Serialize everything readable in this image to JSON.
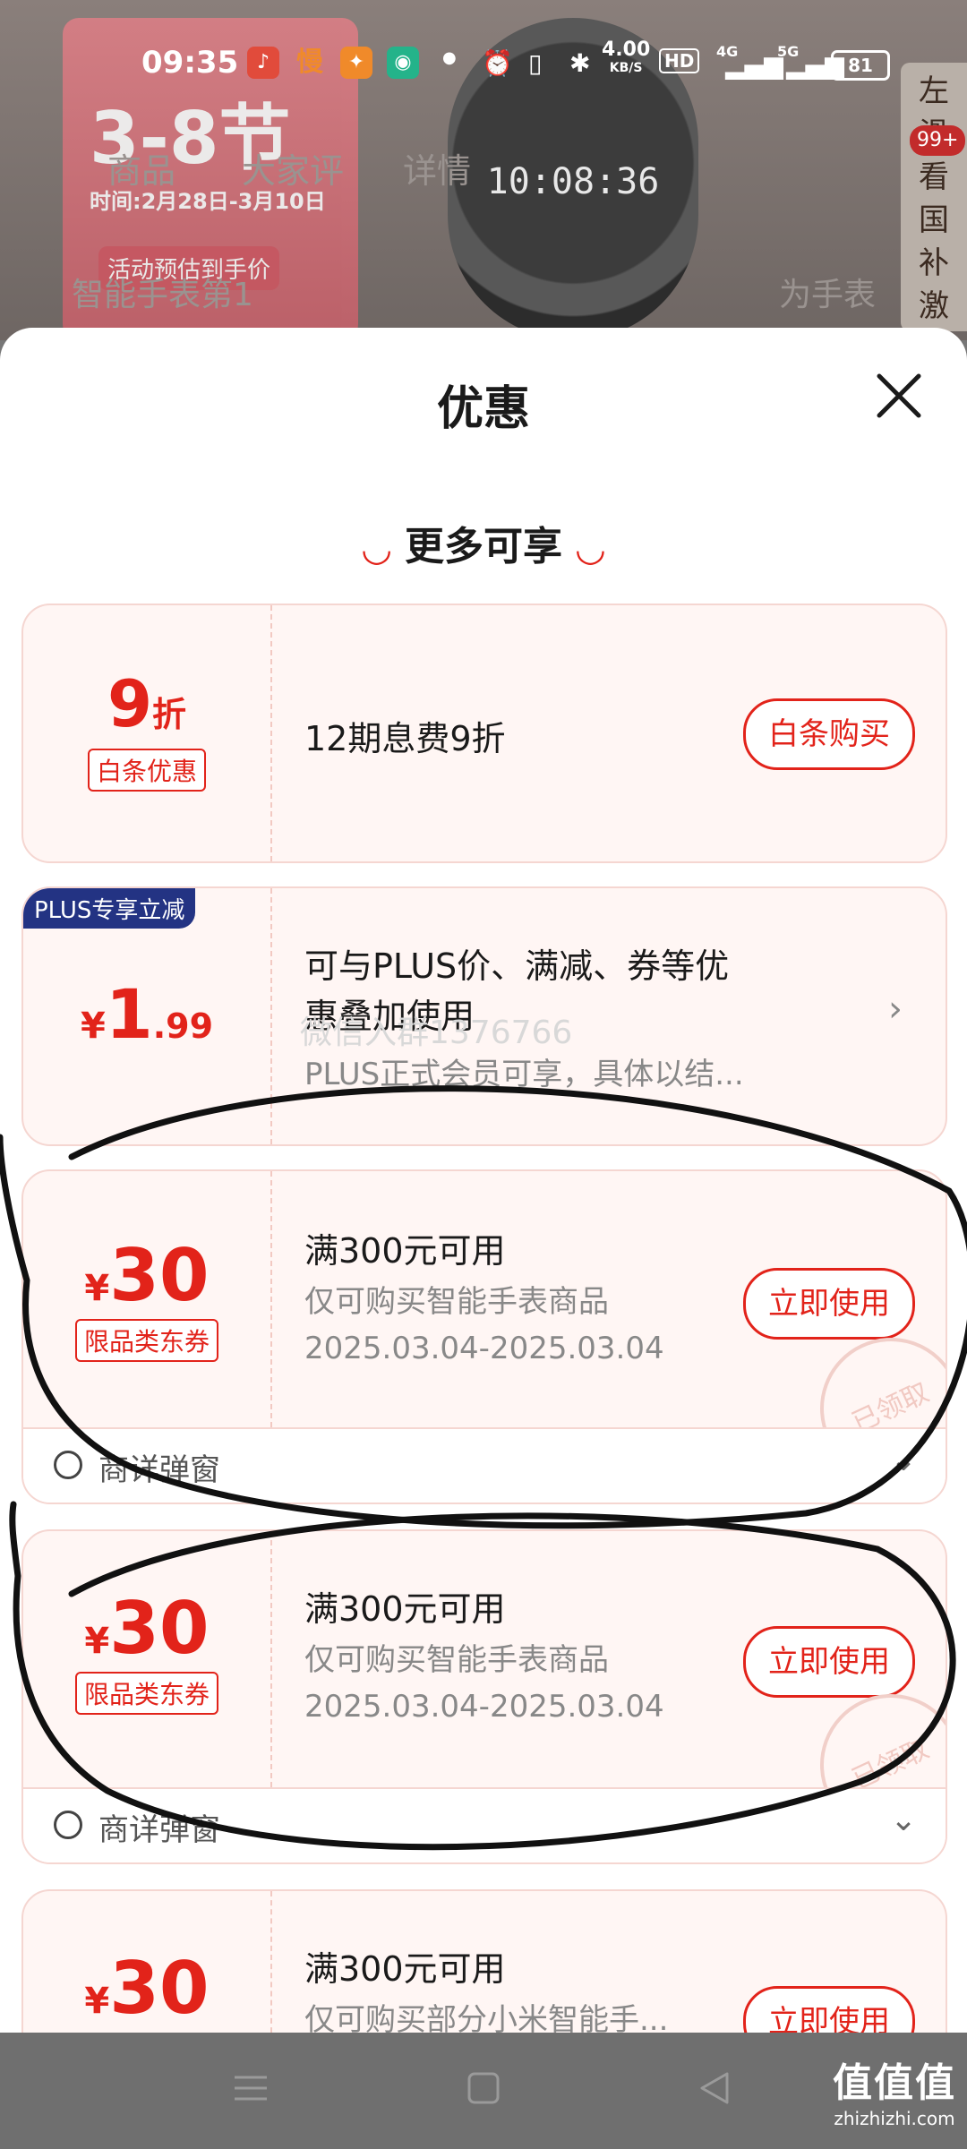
{
  "status": {
    "time": "09:35",
    "net_speed": "4.00",
    "net_unit": "KB/S",
    "hd": "HD",
    "sig1": "4G",
    "sig2": "5G",
    "battery": "81"
  },
  "background_page": {
    "promo_title": "3-8节",
    "promo_date": "时间:2月28日-3月10日",
    "promo_note": "活动预估到手价",
    "watch_time": "10:08:36",
    "tabs": [
      "商品",
      "大家评",
      "详情"
    ],
    "search_text": "智能手表第1",
    "search_right": "为手表",
    "side_text": "左滑看国补激活",
    "side_count": "99+"
  },
  "sheet": {
    "title": "优惠",
    "section": "更多可享"
  },
  "cards": [
    {
      "amount": "9",
      "unit": "折",
      "tag": "白条优惠",
      "main": "12期息费9折",
      "button": "白条购买"
    },
    {
      "badge": "PLUS专享立减",
      "currency": "¥",
      "amount": "1",
      "decimal": ".99",
      "main_line1": "可与PLUS价、满减、券等优",
      "main_line2": "惠叠加使用",
      "sub": "PLUS正式会员可享，具体以结..."
    },
    {
      "currency": "¥",
      "amount": "30",
      "tag": "限品类东券",
      "main": "满300元可用",
      "sub1": "仅可购买智能手表商品",
      "sub2": "2025.03.04-2025.03.04",
      "button": "立即使用",
      "stamp": "已领取",
      "footer": "商详弹窗"
    },
    {
      "currency": "¥",
      "amount": "30",
      "tag": "限品类东券",
      "main": "满300元可用",
      "sub1": "仅可购买智能手表商品",
      "sub2": "2025.03.04-2025.03.04",
      "button": "立即使用",
      "stamp": "已领取",
      "footer": "商详弹窗"
    },
    {
      "currency": "¥",
      "amount": "30",
      "main": "满300元可用",
      "sub1": "仅可购买部分小米智能手...",
      "button": "立即使用"
    }
  ],
  "watermark": "微信入群1376766",
  "brand": {
    "name": "值值值",
    "url": "zhizhizhi.com"
  },
  "colors": {
    "accent": "#e2231a",
    "plus": "#233383"
  }
}
